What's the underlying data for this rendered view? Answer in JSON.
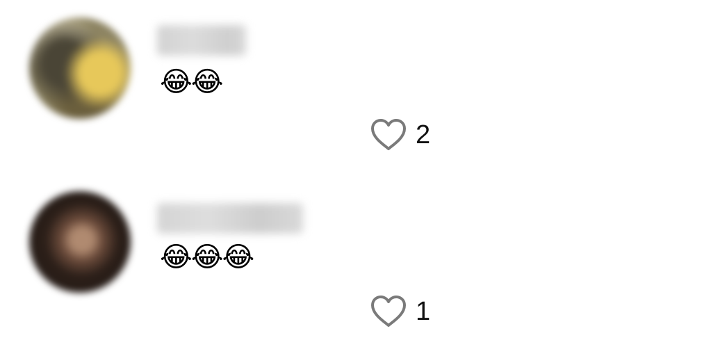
{
  "comments": [
    {
      "username": "lillinna",
      "text": "😂😂",
      "like_count": "2",
      "like_icon": "heart-outline-icon"
    },
    {
      "username": "alhuaragnoo",
      "text": "😂😂😂",
      "like_count": "1",
      "like_icon": "heart-outline-icon"
    }
  ],
  "colors": {
    "heart_stroke": "#7a7a7a",
    "count_text": "#111111",
    "background": "#ffffff"
  }
}
